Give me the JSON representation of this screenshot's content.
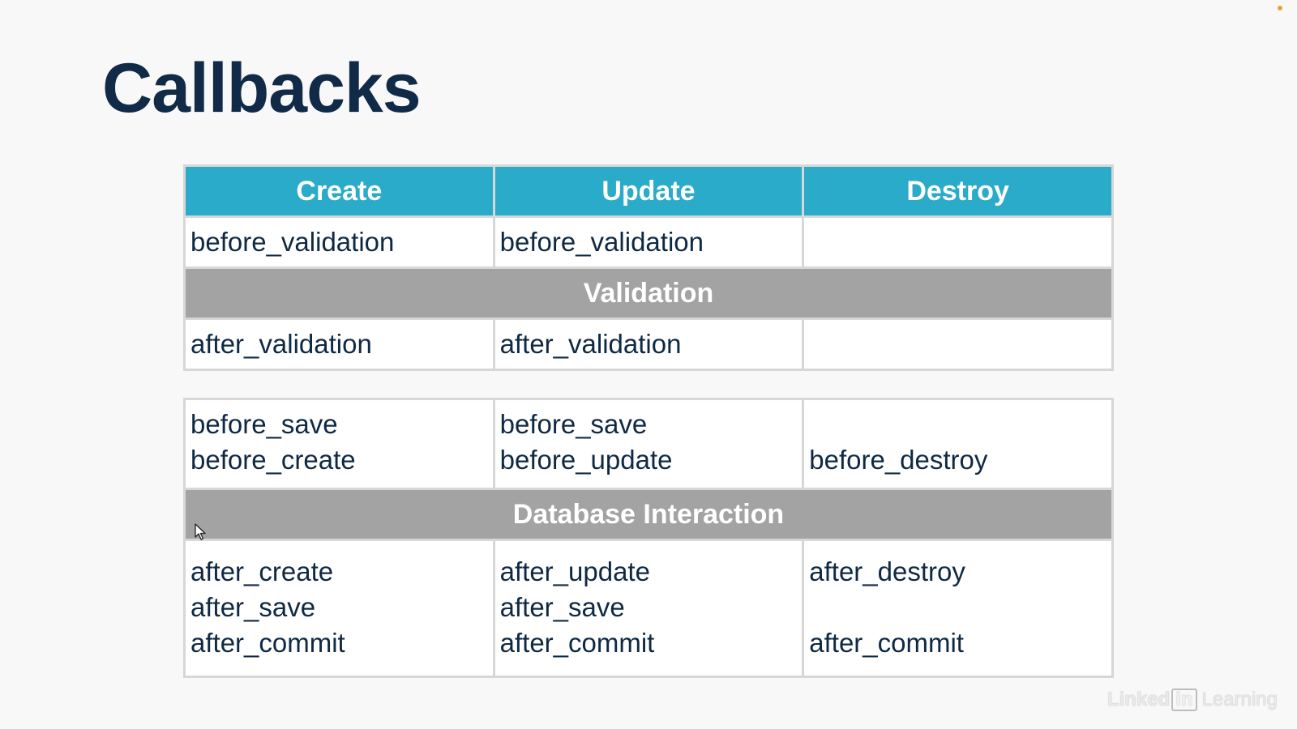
{
  "slide": {
    "title": "Callbacks"
  },
  "table1": {
    "headers": [
      "Create",
      "Update",
      "Destroy"
    ],
    "before_row": [
      "before_validation",
      "before_validation",
      ""
    ],
    "band_label": "Validation",
    "after_row": [
      "after_validation",
      "after_validation",
      ""
    ]
  },
  "table2": {
    "before_row": [
      [
        "before_save",
        "before_create"
      ],
      [
        "before_save",
        "before_update"
      ],
      [
        "",
        "before_destroy"
      ]
    ],
    "band_label": "Database Interaction",
    "after_row": [
      [
        "after_create",
        "after_save",
        "after_commit"
      ],
      [
        "after_update",
        "after_save",
        "after_commit"
      ],
      [
        "after_destroy",
        "",
        "after_commit"
      ]
    ]
  },
  "watermark": {
    "brand_left": "Linked",
    "brand_box": "in",
    "brand_right": "Learning"
  },
  "colors": {
    "header_bg": "#2aabc9",
    "band_bg": "#a3a3a3",
    "title": "#102a47"
  },
  "icons": [
    "mouse-cursor-icon",
    "recording-dot-icon"
  ]
}
